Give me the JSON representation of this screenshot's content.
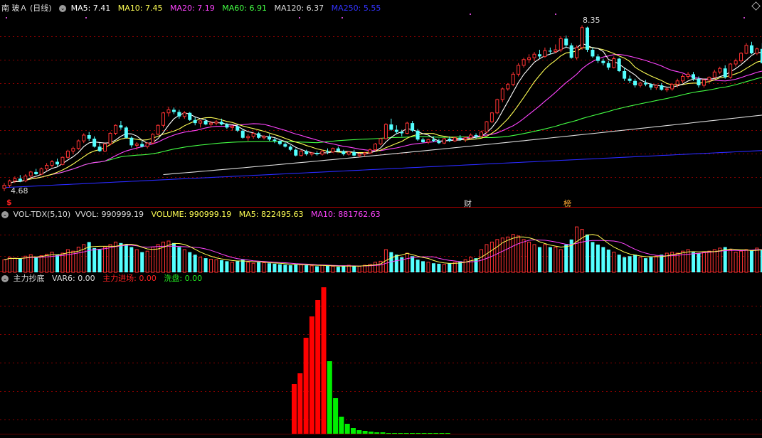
{
  "header": {
    "stock_name": "南 玻Ａ (日线)",
    "ma": [
      {
        "label": "MA5: 7.41",
        "color": "#ffffff"
      },
      {
        "label": "MA10: 7.45",
        "color": "#ffff55"
      },
      {
        "label": "MA20: 7.19",
        "color": "#ff44ff"
      },
      {
        "label": "MA60: 6.91",
        "color": "#44ff44"
      },
      {
        "label": "MA120: 6.37",
        "color": "#dddddd"
      },
      {
        "label": "MA250: 5.55",
        "color": "#3333ff"
      }
    ]
  },
  "price_annotations": {
    "high": "8.35",
    "low": "4.68"
  },
  "event_markers": [
    {
      "label": "$",
      "color": "#ff2222"
    },
    {
      "label": "财",
      "color": "#dddddd"
    },
    {
      "label": "榜",
      "color": "#ffaa33"
    }
  ],
  "volume_panel": {
    "name": "VOL-TDX(5,10)",
    "vvol": "VVOL: 990999.19",
    "volume": "VOLUME: 990999.19",
    "ma5": "MA5: 822495.63",
    "ma10": "MA10: 881762.63"
  },
  "indicator_panel": {
    "name": "主力抄底",
    "var6": "VAR6: 0.00",
    "main_entry": "主力进场: 0.00",
    "wash": "洗盘: 0.00"
  },
  "colors": {
    "up": "#ff3333",
    "down": "#54ffff",
    "grid": "#8b0000",
    "red": "#ff0000",
    "green": "#00ee00"
  },
  "chart_data": {
    "type": "candlestick",
    "price_ylim": [
      4.6,
      8.6
    ],
    "candles": [
      [
        4.68,
        4.8,
        4.62,
        4.75
      ],
      [
        4.75,
        4.88,
        4.7,
        4.85
      ],
      [
        4.85,
        4.95,
        4.8,
        4.9
      ],
      [
        4.9,
        4.98,
        4.82,
        4.85
      ],
      [
        4.85,
        5.0,
        4.82,
        4.96
      ],
      [
        4.96,
        5.08,
        4.92,
        5.05
      ],
      [
        5.05,
        5.12,
        4.98,
        5.0
      ],
      [
        5.0,
        5.15,
        4.98,
        5.12
      ],
      [
        5.12,
        5.25,
        5.08,
        5.2
      ],
      [
        5.2,
        5.32,
        5.15,
        5.28
      ],
      [
        5.28,
        5.35,
        5.18,
        5.22
      ],
      [
        5.22,
        5.4,
        5.2,
        5.38
      ],
      [
        5.38,
        5.55,
        5.35,
        5.52
      ],
      [
        5.52,
        5.62,
        5.45,
        5.58
      ],
      [
        5.58,
        5.78,
        5.55,
        5.75
      ],
      [
        5.75,
        5.92,
        5.7,
        5.88
      ],
      [
        5.88,
        5.95,
        5.75,
        5.8
      ],
      [
        5.8,
        5.85,
        5.6,
        5.62
      ],
      [
        5.62,
        5.7,
        5.5,
        5.52
      ],
      [
        5.52,
        5.7,
        5.5,
        5.68
      ],
      [
        5.68,
        5.95,
        5.65,
        5.92
      ],
      [
        5.92,
        6.12,
        5.88,
        6.1
      ],
      [
        6.1,
        6.2,
        6.0,
        6.05
      ],
      [
        6.05,
        6.08,
        5.8,
        5.82
      ],
      [
        5.82,
        5.85,
        5.6,
        5.65
      ],
      [
        5.65,
        5.72,
        5.55,
        5.68
      ],
      [
        5.68,
        5.75,
        5.6,
        5.62
      ],
      [
        5.62,
        5.72,
        5.58,
        5.7
      ],
      [
        5.7,
        5.92,
        5.68,
        5.9
      ],
      [
        5.9,
        6.12,
        5.88,
        6.1
      ],
      [
        6.1,
        6.4,
        6.05,
        6.38
      ],
      [
        6.38,
        6.52,
        6.3,
        6.45
      ],
      [
        6.45,
        6.5,
        6.35,
        6.4
      ],
      [
        6.4,
        6.45,
        6.25,
        6.3
      ],
      [
        6.3,
        6.42,
        6.25,
        6.38
      ],
      [
        6.38,
        6.4,
        6.2,
        6.22
      ],
      [
        6.22,
        6.28,
        6.1,
        6.15
      ],
      [
        6.15,
        6.22,
        6.05,
        6.2
      ],
      [
        6.2,
        6.25,
        6.1,
        6.12
      ],
      [
        6.12,
        6.2,
        6.05,
        6.15
      ],
      [
        6.15,
        6.22,
        6.1,
        6.18
      ],
      [
        6.18,
        6.25,
        6.1,
        6.12
      ],
      [
        6.12,
        6.15,
        6.02,
        6.05
      ],
      [
        6.05,
        6.1,
        5.98,
        6.08
      ],
      [
        6.08,
        6.12,
        5.95,
        5.98
      ],
      [
        5.98,
        6.02,
        5.8,
        5.82
      ],
      [
        5.82,
        5.9,
        5.75,
        5.85
      ],
      [
        5.85,
        5.95,
        5.8,
        5.92
      ],
      [
        5.92,
        5.95,
        5.8,
        5.82
      ],
      [
        5.82,
        5.88,
        5.78,
        5.85
      ],
      [
        5.85,
        5.9,
        5.75,
        5.78
      ],
      [
        5.78,
        5.82,
        5.7,
        5.75
      ],
      [
        5.75,
        5.78,
        5.65,
        5.68
      ],
      [
        5.68,
        5.72,
        5.6,
        5.62
      ],
      [
        5.62,
        5.65,
        5.52,
        5.55
      ],
      [
        5.55,
        5.58,
        5.4,
        5.42
      ],
      [
        5.42,
        5.55,
        5.4,
        5.52
      ],
      [
        5.52,
        5.55,
        5.42,
        5.45
      ],
      [
        5.45,
        5.5,
        5.4,
        5.48
      ],
      [
        5.48,
        5.52,
        5.42,
        5.45
      ],
      [
        5.45,
        5.55,
        5.42,
        5.52
      ],
      [
        5.52,
        5.58,
        5.45,
        5.5
      ],
      [
        5.5,
        5.6,
        5.48,
        5.58
      ],
      [
        5.58,
        5.62,
        5.5,
        5.52
      ],
      [
        5.52,
        5.55,
        5.42,
        5.45
      ],
      [
        5.45,
        5.52,
        5.42,
        5.5
      ],
      [
        5.5,
        5.55,
        5.4,
        5.42
      ],
      [
        5.42,
        5.48,
        5.38,
        5.45
      ],
      [
        5.45,
        5.5,
        5.4,
        5.48
      ],
      [
        5.48,
        5.58,
        5.45,
        5.55
      ],
      [
        5.55,
        5.7,
        5.52,
        5.68
      ],
      [
        5.68,
        5.82,
        5.65,
        5.8
      ],
      [
        5.8,
        6.15,
        5.78,
        6.12
      ],
      [
        6.12,
        6.25,
        5.98,
        6.0
      ],
      [
        6.0,
        6.1,
        5.9,
        5.95
      ],
      [
        5.95,
        6.0,
        5.85,
        5.92
      ],
      [
        5.92,
        6.18,
        5.9,
        6.15
      ],
      [
        6.15,
        6.2,
        5.95,
        5.98
      ],
      [
        5.98,
        6.02,
        5.75,
        5.78
      ],
      [
        5.78,
        5.82,
        5.7,
        5.72
      ],
      [
        5.72,
        5.8,
        5.68,
        5.78
      ],
      [
        5.78,
        5.85,
        5.72,
        5.75
      ],
      [
        5.75,
        5.8,
        5.68,
        5.7
      ],
      [
        5.7,
        5.82,
        5.68,
        5.8
      ],
      [
        5.8,
        5.85,
        5.72,
        5.75
      ],
      [
        5.75,
        5.85,
        5.72,
        5.82
      ],
      [
        5.82,
        5.88,
        5.75,
        5.78
      ],
      [
        5.78,
        5.85,
        5.72,
        5.82
      ],
      [
        5.82,
        5.92,
        5.8,
        5.88
      ],
      [
        5.88,
        5.92,
        5.8,
        5.85
      ],
      [
        5.85,
        5.98,
        5.82,
        5.95
      ],
      [
        5.95,
        6.2,
        5.92,
        6.18
      ],
      [
        6.18,
        6.4,
        6.15,
        6.38
      ],
      [
        6.38,
        6.7,
        6.35,
        6.68
      ],
      [
        6.68,
        6.95,
        6.62,
        6.92
      ],
      [
        6.92,
        7.05,
        6.88,
        7.02
      ],
      [
        7.02,
        7.3,
        6.98,
        7.25
      ],
      [
        7.25,
        7.5,
        7.2,
        7.45
      ],
      [
        7.45,
        7.62,
        7.4,
        7.58
      ],
      [
        7.58,
        7.7,
        7.5,
        7.62
      ],
      [
        7.62,
        7.75,
        7.55,
        7.7
      ],
      [
        7.7,
        7.8,
        7.6,
        7.65
      ],
      [
        7.65,
        7.85,
        7.62,
        7.78
      ],
      [
        7.78,
        7.85,
        7.7,
        7.76
      ],
      [
        7.76,
        7.92,
        7.72,
        7.8
      ],
      [
        7.8,
        8.1,
        7.75,
        8.05
      ],
      [
        8.05,
        8.12,
        7.85,
        7.9
      ],
      [
        7.9,
        7.95,
        7.6,
        7.62
      ],
      [
        7.62,
        7.9,
        7.58,
        7.85
      ],
      [
        7.85,
        8.35,
        7.8,
        8.3
      ],
      [
        8.3,
        8.32,
        7.75,
        7.8
      ],
      [
        7.8,
        7.85,
        7.62,
        7.65
      ],
      [
        7.65,
        7.7,
        7.5,
        7.55
      ],
      [
        7.55,
        7.6,
        7.45,
        7.5
      ],
      [
        7.5,
        7.55,
        7.35,
        7.4
      ],
      [
        7.4,
        7.65,
        7.38,
        7.6
      ],
      [
        7.6,
        7.62,
        7.3,
        7.32
      ],
      [
        7.32,
        7.4,
        7.1,
        7.15
      ],
      [
        7.15,
        7.22,
        7.05,
        7.1
      ],
      [
        7.1,
        7.15,
        6.95,
        7.0
      ],
      [
        7.0,
        7.08,
        6.95,
        7.05
      ],
      [
        7.05,
        7.12,
        6.98,
        7.02
      ],
      [
        7.02,
        7.05,
        6.9,
        6.95
      ],
      [
        6.95,
        7.02,
        6.9,
        7.0
      ],
      [
        7.0,
        7.05,
        6.88,
        6.9
      ],
      [
        6.9,
        6.95,
        6.85,
        6.92
      ],
      [
        6.92,
        7.05,
        6.88,
        7.02
      ],
      [
        7.02,
        7.15,
        6.95,
        7.1
      ],
      [
        7.1,
        7.25,
        7.05,
        7.2
      ],
      [
        7.2,
        7.3,
        7.15,
        7.25
      ],
      [
        7.25,
        7.3,
        7.1,
        7.15
      ],
      [
        7.15,
        7.2,
        6.95,
        7.0
      ],
      [
        7.0,
        7.15,
        6.95,
        7.12
      ],
      [
        7.12,
        7.2,
        7.05,
        7.18
      ],
      [
        7.18,
        7.35,
        7.15,
        7.3
      ],
      [
        7.3,
        7.42,
        7.25,
        7.38
      ],
      [
        7.38,
        7.45,
        7.15,
        7.18
      ],
      [
        7.18,
        7.5,
        7.15,
        7.48
      ],
      [
        7.48,
        7.6,
        7.42,
        7.55
      ],
      [
        7.55,
        7.75,
        7.5,
        7.72
      ],
      [
        7.72,
        7.95,
        7.7,
        7.9
      ],
      [
        7.9,
        7.98,
        7.7,
        7.72
      ],
      [
        7.72,
        7.85,
        7.68,
        7.82
      ],
      [
        7.82,
        7.95,
        7.48,
        7.5
      ],
      [
        7.5,
        7.68,
        7.45,
        7.65
      ],
      [
        7.65,
        7.72,
        7.58,
        7.6
      ],
      [
        7.6,
        7.82,
        7.58,
        7.8
      ]
    ],
    "volumes": [
      0.25,
      0.3,
      0.28,
      0.27,
      0.32,
      0.35,
      0.3,
      0.33,
      0.36,
      0.4,
      0.35,
      0.38,
      0.45,
      0.42,
      0.5,
      0.55,
      0.6,
      0.48,
      0.45,
      0.5,
      0.55,
      0.6,
      0.58,
      0.55,
      0.5,
      0.45,
      0.4,
      0.42,
      0.5,
      0.55,
      0.6,
      0.62,
      0.58,
      0.5,
      0.45,
      0.4,
      0.35,
      0.3,
      0.28,
      0.26,
      0.25,
      0.24,
      0.22,
      0.2,
      0.22,
      0.25,
      0.2,
      0.18,
      0.2,
      0.19,
      0.18,
      0.17,
      0.16,
      0.15,
      0.14,
      0.16,
      0.15,
      0.14,
      0.13,
      0.12,
      0.14,
      0.13,
      0.12,
      0.11,
      0.12,
      0.14,
      0.13,
      0.12,
      0.14,
      0.16,
      0.2,
      0.22,
      0.45,
      0.4,
      0.35,
      0.3,
      0.38,
      0.32,
      0.25,
      0.22,
      0.2,
      0.18,
      0.17,
      0.16,
      0.18,
      0.2,
      0.22,
      0.25,
      0.3,
      0.28,
      0.45,
      0.55,
      0.6,
      0.65,
      0.68,
      0.7,
      0.75,
      0.72,
      0.65,
      0.6,
      0.55,
      0.5,
      0.55,
      0.5,
      0.5,
      0.45,
      0.55,
      0.65,
      0.9,
      0.85,
      0.75,
      0.6,
      0.55,
      0.5,
      0.45,
      0.4,
      0.35,
      0.3,
      0.32,
      0.35,
      0.3,
      0.28,
      0.3,
      0.32,
      0.35,
      0.38,
      0.4,
      0.38,
      0.42,
      0.45,
      0.4,
      0.38,
      0.4,
      0.42,
      0.45,
      0.48,
      0.5,
      0.45,
      0.4,
      0.42,
      0.45,
      0.43,
      0.48,
      0.45,
      0.48
    ],
    "indicator_bars": [
      {
        "v": 70,
        "c": "red"
      },
      {
        "v": 85,
        "c": "red"
      },
      {
        "v": 135,
        "c": "red"
      },
      {
        "v": 165,
        "c": "red"
      },
      {
        "v": 188,
        "c": "red"
      },
      {
        "v": 206,
        "c": "red"
      },
      {
        "v": 102,
        "c": "green"
      },
      {
        "v": 50,
        "c": "green"
      },
      {
        "v": 24,
        "c": "green"
      },
      {
        "v": 14,
        "c": "green"
      },
      {
        "v": 8,
        "c": "green"
      },
      {
        "v": 5,
        "c": "green"
      },
      {
        "v": 4,
        "c": "green"
      },
      {
        "v": 3,
        "c": "green"
      },
      {
        "v": 2,
        "c": "green"
      },
      {
        "v": 2,
        "c": "green"
      },
      {
        "v": 1,
        "c": "green"
      },
      {
        "v": 1,
        "c": "green"
      },
      {
        "v": 1,
        "c": "green"
      },
      {
        "v": 1,
        "c": "green"
      },
      {
        "v": 1,
        "c": "green"
      },
      {
        "v": 1,
        "c": "green"
      },
      {
        "v": 1,
        "c": "green"
      },
      {
        "v": 1,
        "c": "green"
      },
      {
        "v": 1,
        "c": "green"
      },
      {
        "v": 1,
        "c": "green"
      },
      {
        "v": 1,
        "c": "green"
      }
    ]
  }
}
